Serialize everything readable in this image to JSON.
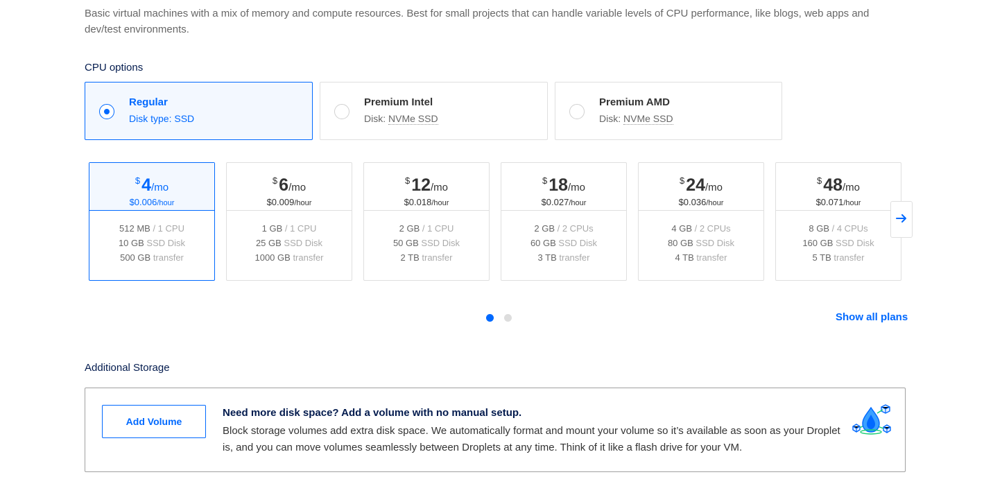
{
  "intro": {
    "description": "Basic virtual machines with a mix of memory and compute resources. Best for small projects that can handle variable levels of CPU performance, like blogs, web apps and dev/test environments."
  },
  "cpu_options": {
    "title": "CPU options",
    "options": [
      {
        "name": "Regular",
        "disk_label": "Disk type:",
        "disk_value": "SSD",
        "selected": true
      },
      {
        "name": "Premium Intel",
        "disk_label": "Disk:",
        "disk_value": "NVMe SSD",
        "selected": false
      },
      {
        "name": "Premium AMD",
        "disk_label": "Disk:",
        "disk_value": "NVMe SSD",
        "selected": false
      }
    ]
  },
  "plans": {
    "currency": "$",
    "per_month": "/mo",
    "per_hour": "/hour",
    "selected_index": 0,
    "items": [
      {
        "price": "4",
        "hourly": "$0.006",
        "memory": "512 MB",
        "cpu": "/ 1 CPU",
        "disk": "10 GB",
        "disk_label": "SSD Disk",
        "transfer": "500 GB",
        "transfer_label": "transfer"
      },
      {
        "price": "6",
        "hourly": "$0.009",
        "memory": "1 GB",
        "cpu": "/ 1 CPU",
        "disk": "25 GB",
        "disk_label": "SSD Disk",
        "transfer": "1000 GB",
        "transfer_label": "transfer"
      },
      {
        "price": "12",
        "hourly": "$0.018",
        "memory": "2 GB",
        "cpu": "/ 1 CPU",
        "disk": "50 GB",
        "disk_label": "SSD Disk",
        "transfer": "2 TB",
        "transfer_label": "transfer"
      },
      {
        "price": "18",
        "hourly": "$0.027",
        "memory": "2 GB",
        "cpu": "/ 2 CPUs",
        "disk": "60 GB",
        "disk_label": "SSD Disk",
        "transfer": "3 TB",
        "transfer_label": "transfer"
      },
      {
        "price": "24",
        "hourly": "$0.036",
        "memory": "4 GB",
        "cpu": "/ 2 CPUs",
        "disk": "80 GB",
        "disk_label": "SSD Disk",
        "transfer": "4 TB",
        "transfer_label": "transfer"
      },
      {
        "price": "48",
        "hourly": "$0.071",
        "memory": "8 GB",
        "cpu": "/ 4 CPUs",
        "disk": "160 GB",
        "disk_label": "SSD Disk",
        "transfer": "5 TB",
        "transfer_label": "transfer"
      }
    ],
    "next_icon": "arrow-right-icon",
    "pagination": {
      "pages": 2,
      "current": 1
    },
    "show_all_label": "Show all plans"
  },
  "additional_storage": {
    "title": "Additional Storage",
    "add_volume_label": "Add Volume",
    "headline": "Need more disk space? Add a volume with no manual setup.",
    "description": "Block storage volumes add extra disk space. We automatically format and mount your volume so it’s available as soon as your Droplet is, and you can move volumes seamlessly between Droplets at any time. Think of it like a flash drive for your VM.",
    "illustration_icon": "volume-droplet-icon"
  },
  "colors": {
    "accent": "#0069ff",
    "selected_bg": "#f3f8ff",
    "border": "#dfdfdf",
    "muted_text": "#aaaaaa",
    "heading": "#031b4e"
  }
}
